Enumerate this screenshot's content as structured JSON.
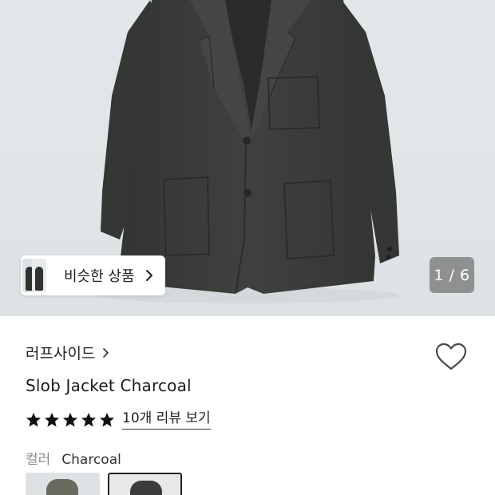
{
  "hero": {
    "similar_button_label": "비슷한 상품",
    "pager_text": "1 / 6"
  },
  "product": {
    "brand": "러프사이드",
    "name": "Slob Jacket Charcoal",
    "rating": {
      "stars": 5,
      "review_link": "10개 리뷰 보기"
    },
    "color": {
      "label": "컬러",
      "value": "Charcoal",
      "options": [
        {
          "garment_color": "#6a6a5f",
          "bg_color": "#dfe2e4",
          "selected": false
        },
        {
          "garment_color": "#3a3c3a",
          "bg_color": "#e6e8ea",
          "selected": true
        }
      ]
    }
  },
  "colors": {
    "star": "#111111",
    "jacket": "#3b3d3b",
    "hero_bg": "#e2e6e9"
  },
  "icons": {
    "chevron": "chevron-right-icon",
    "heart": "heart-outline-icon",
    "star": "star-filled-icon"
  }
}
